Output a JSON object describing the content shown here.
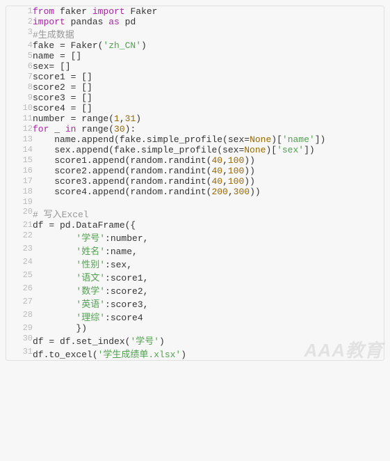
{
  "watermark": "AAA教育",
  "lines": [
    {
      "n": "1",
      "html": "<span class='keyword'>from</span> faker <span class='keyword'>import</span> Faker"
    },
    {
      "n": "2",
      "html": "<span class='keyword'>import</span> pandas <span class='keyword'>as</span> pd"
    },
    {
      "n": "3",
      "html": "<span class='comment'>#生成数据</span>"
    },
    {
      "n": "4",
      "html": "fake = Faker(<span class='string'>'zh_CN'</span>)"
    },
    {
      "n": "5",
      "html": "name = []"
    },
    {
      "n": "6",
      "html": "sex= []"
    },
    {
      "n": "7",
      "html": "score1 = []"
    },
    {
      "n": "8",
      "html": "score2 = []"
    },
    {
      "n": "9",
      "html": "score3 = []"
    },
    {
      "n": "10",
      "html": "score4 = []"
    },
    {
      "n": "11",
      "html": "number = range(<span class='number-lit'>1</span>,<span class='number-lit'>31</span>)"
    },
    {
      "n": "12",
      "html": "<span class='keyword'>for</span> _ <span class='keyword'>in</span> range(<span class='number-lit'>30</span>):"
    },
    {
      "n": "13",
      "html": "    name.append(fake.simple_profile(sex=<span class='none-val'>None</span>)[<span class='string'>'name'</span>])"
    },
    {
      "n": "14",
      "html": "    sex.append(fake.simple_profile(sex=<span class='none-val'>None</span>)[<span class='string'>'sex'</span>])"
    },
    {
      "n": "15",
      "html": "    score1.append(random.randint(<span class='number-lit'>40</span>,<span class='number-lit'>100</span>))"
    },
    {
      "n": "16",
      "html": "    score2.append(random.randint(<span class='number-lit'>40</span>,<span class='number-lit'>100</span>))"
    },
    {
      "n": "17",
      "html": "    score3.append(random.randint(<span class='number-lit'>40</span>,<span class='number-lit'>100</span>))"
    },
    {
      "n": "18",
      "html": "    score4.append(random.randint(<span class='number-lit'>200</span>,<span class='number-lit'>300</span>))"
    },
    {
      "n": "19",
      "html": ""
    },
    {
      "n": "20",
      "html": "<span class='comment'># 写入Excel</span>"
    },
    {
      "n": "21",
      "html": "df = pd.DataFrame({"
    },
    {
      "n": "22",
      "html": "        <span class='string'>'学号'</span>:number,"
    },
    {
      "n": "23",
      "html": "        <span class='string'>'姓名'</span>:name,"
    },
    {
      "n": "24",
      "html": "        <span class='string'>'性别'</span>:sex,"
    },
    {
      "n": "25",
      "html": "        <span class='string'>'语文'</span>:score1,"
    },
    {
      "n": "26",
      "html": "        <span class='string'>'数学'</span>:score2,"
    },
    {
      "n": "27",
      "html": "        <span class='string'>'英语'</span>:score3,"
    },
    {
      "n": "28",
      "html": "        <span class='string'>'理综'</span>:score4"
    },
    {
      "n": "29",
      "html": "        })"
    },
    {
      "n": "30",
      "html": "df = df.set_index(<span class='string'>'学号'</span>)"
    },
    {
      "n": "31",
      "html": "df.to_excel(<span class='string'>'学生成绩单.xlsx'</span>)"
    }
  ]
}
